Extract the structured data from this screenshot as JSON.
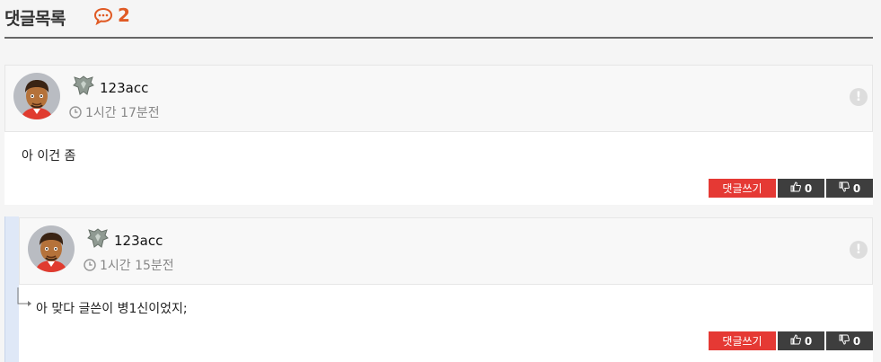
{
  "header": {
    "title": "댓글목록",
    "count": "2"
  },
  "comments": [
    {
      "username": "123acc",
      "time": "1시간 17분전",
      "body": "아 이건 좀",
      "more": "!",
      "reply_label": "댓글쓰기",
      "likes": "0",
      "dislikes": "0"
    },
    {
      "username": "123acc",
      "time": "1시간 15분전",
      "body": "아 맞다 글쓴이 병1신이었지;",
      "more": "!",
      "reply_label": "댓글쓰기",
      "likes": "0",
      "dislikes": "0"
    }
  ],
  "colors": {
    "accent": "#e05a24",
    "reply_button": "#e53934",
    "vote_button": "#3e3e3e"
  },
  "icons": [
    "comment-icon",
    "clock-icon",
    "level-badge-icon",
    "thumbs-up-icon",
    "thumbs-down-icon",
    "more-icon",
    "reply-arrow-icon"
  ]
}
